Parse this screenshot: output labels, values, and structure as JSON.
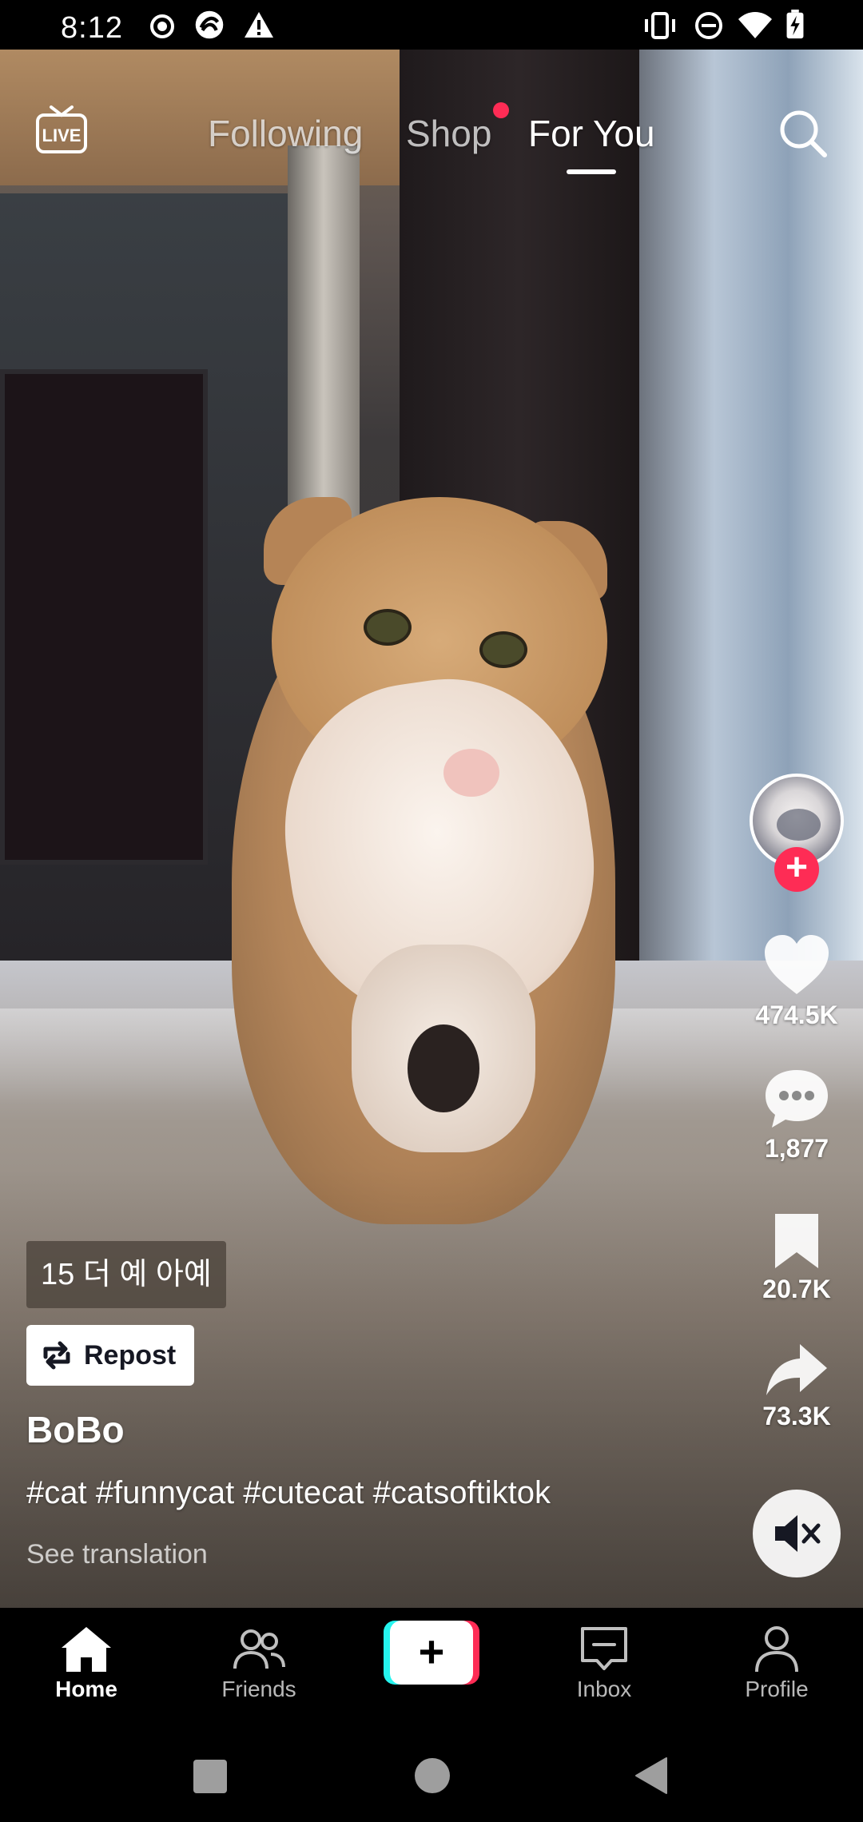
{
  "status_bar": {
    "time": "8:12",
    "icons": [
      "record-icon",
      "app-icon",
      "warning-icon",
      "vibrate-icon",
      "do-not-disturb-icon",
      "wifi-icon",
      "battery-charging-icon"
    ]
  },
  "top_nav": {
    "live_icon": "live-tv-icon",
    "live_label": "LIVE",
    "tabs": [
      {
        "label": "Following",
        "active": false
      },
      {
        "label": "Shop",
        "active": false,
        "has_dot": true
      },
      {
        "label": "For You",
        "active": true
      }
    ],
    "search_icon": "search-icon"
  },
  "video": {
    "description": "cat-video"
  },
  "right_rail": {
    "creator_avatar": "creator-avatar",
    "follow_symbol": "+",
    "likes": "474.5K",
    "comments": "1,877",
    "saves": "20.7K",
    "shares": "73.3K",
    "mute_icon": "volume-muted-icon"
  },
  "caption": {
    "tag_chip": "15 더 예 아예",
    "repost_label": "Repost",
    "username": "BoBo",
    "hashtags": "#cat #funnycat #cutecat #catsoftiktok",
    "see_translation": "See translation"
  },
  "tab_bar": {
    "items": [
      {
        "label": "Home",
        "icon": "home-icon",
        "active": true
      },
      {
        "label": "Friends",
        "icon": "friends-icon",
        "active": false
      },
      {
        "label": "",
        "icon": "create-plus-icon",
        "active": false
      },
      {
        "label": "Inbox",
        "icon": "inbox-icon",
        "active": false
      },
      {
        "label": "Profile",
        "icon": "profile-icon",
        "active": false
      }
    ],
    "create_symbol": "+"
  },
  "colors": {
    "accent_red": "#fe2c55",
    "accent_cyan": "#25f4ee",
    "background": "#000000"
  }
}
